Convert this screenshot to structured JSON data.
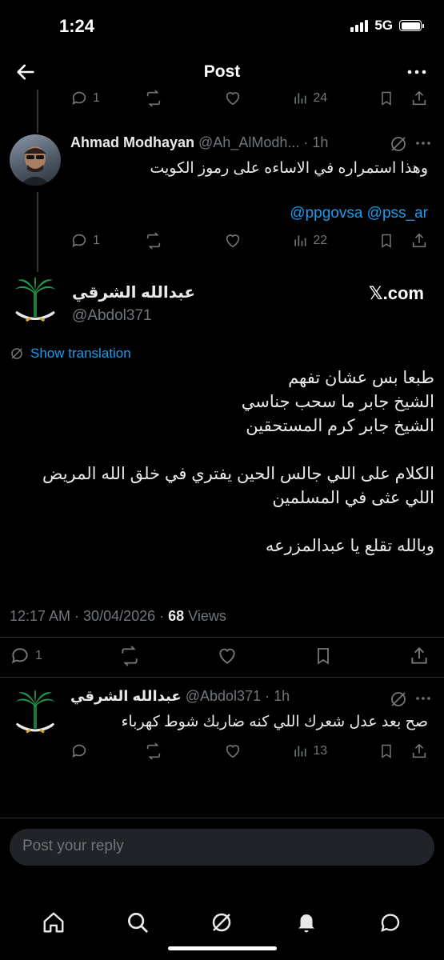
{
  "status_bar": {
    "time": "1:24",
    "network": "5G"
  },
  "header": {
    "title": "Post"
  },
  "prev_post_actions": {
    "replies": "1",
    "views": "24"
  },
  "reply_post": {
    "author_name": "Ahmad Modhayan",
    "author_handle": "@Ah_AlModh...",
    "time": "1h",
    "text": "وهذا استمراره في الاساءه على رموز الكويت",
    "mentions": "@ppgovsa @pss_ar",
    "replies": "1",
    "views": "22"
  },
  "main_post": {
    "author_name": "عبدالله الشرقي",
    "author_handle": "@Abdol371",
    "source": "𝕏.com",
    "show_translation": "Show translation",
    "lines": [
      "طبعا بس عشان تفهم",
      "الشيخ جابر ما سحب جناسي",
      "الشيخ جابر كرم المستحقين",
      "",
      "الكلام على اللي جالس الحين يفتري في خلق الله المريض",
      "اللي عثى في المسلمين",
      "",
      "وبالله تقلع يا عبدالمزرعه"
    ],
    "timestamp": "12:17 AM · 30/04/2026 · ",
    "views_count": "68",
    "views_label": " Views",
    "replies": "1"
  },
  "comment": {
    "author_name": "عبدالله الشرقي",
    "author_handle": "@Abdol371",
    "time": "1h",
    "text": "صح بعد عدل شعرك اللي كنه ضاربك شوط كهرباء",
    "views": "13"
  },
  "reply_input": {
    "placeholder": "Post your reply"
  },
  "nav": [
    "home-icon",
    "search-icon",
    "grok-icon",
    "notifications-icon",
    "messages-icon"
  ],
  "colors": {
    "link": "#1d9bf0",
    "muted": "#71767b",
    "text": "#e7e9ea",
    "background": "#000000"
  }
}
